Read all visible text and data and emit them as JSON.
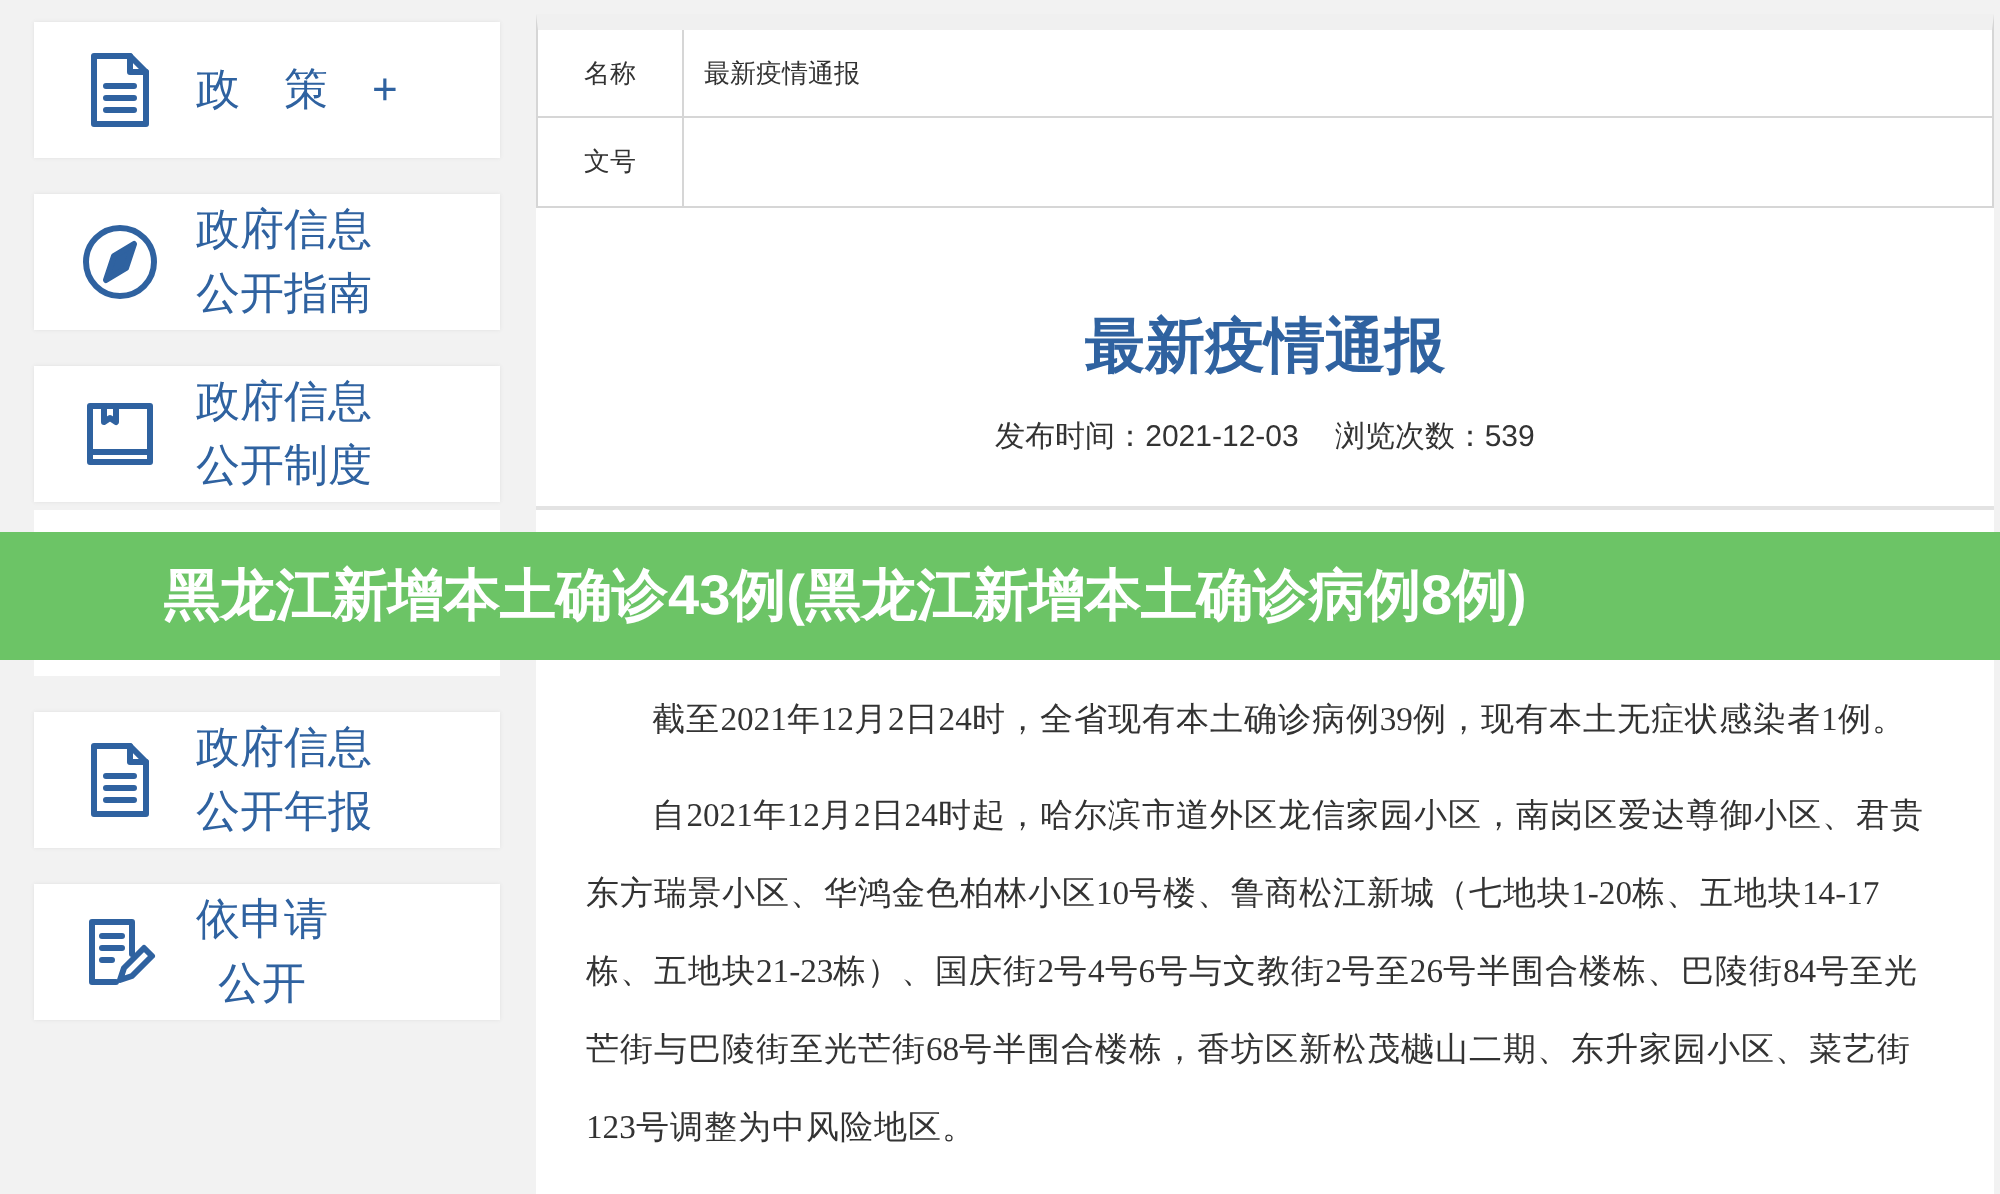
{
  "sidebar": {
    "items": [
      {
        "kind": "document",
        "lines": [
          "政　策　+"
        ]
      },
      {
        "kind": "compass",
        "lines": [
          "政府信息",
          "公开指南"
        ]
      },
      {
        "kind": "book",
        "lines": [
          "政府信息",
          "公开制度"
        ]
      },
      {
        "kind": "document",
        "lines": [
          "政府信息",
          "公开年报"
        ]
      },
      {
        "kind": "edit",
        "lines": [
          "依申请",
          "公开"
        ]
      }
    ]
  },
  "info_table": {
    "rows": [
      {
        "label": "名称",
        "value": "最新疫情通报"
      },
      {
        "label": "文号"
      }
    ]
  },
  "article": {
    "title": "最新疫情通报",
    "meta": [
      {
        "label": "发布时间：",
        "value": "2021-12-03"
      },
      {
        "label": "浏览次数：",
        "value": "539"
      }
    ],
    "paragraphs": [
      "截至2021年12月2日24时，全省现有本土确诊病例39例，现有本土无症状感染者1例。",
      "自2021年12月2日24时起，哈尔滨市道外区龙信家园小区，南岗区爱达尊御小区、君贵东方瑞景小区、华鸿金色柏林小区10号楼、鲁商松江新城（七地块1-20栋、五地块14-17栋、五地块21-23栋）、国庆街2号4号6号与文教街2号至26号半围合楼栋、巴陵街84号至光芒街与巴陵街至光芒街68号半围合楼栋，香坊区新松茂樾山二期、东升家园小区、菜艺街123号调整为中风险地区。"
    ]
  },
  "banner": {
    "text": "黑龙江新增本土确诊43例(黑龙江新增本土确诊病例8例)"
  }
}
